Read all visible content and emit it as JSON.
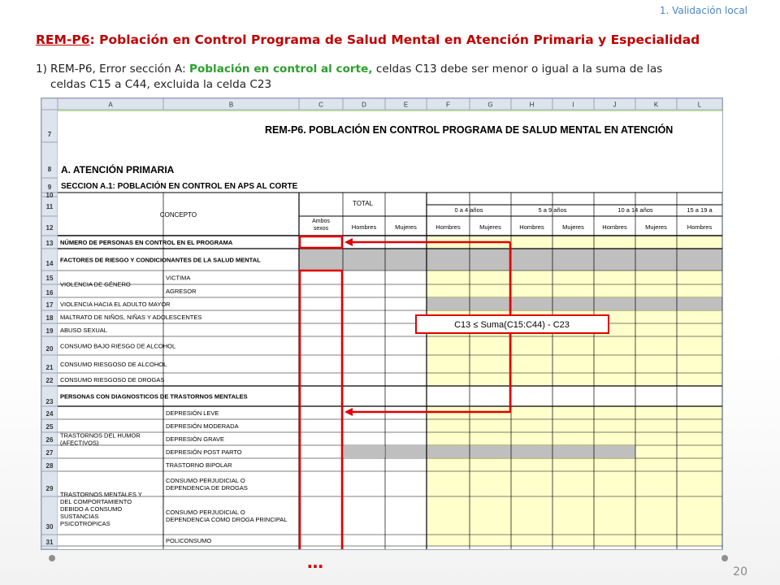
{
  "header": {
    "section_label": "1. Validación local",
    "title_code": "REM-P6",
    "title_rest": ": Población en Control  Programa de Salud  Mental en Atención Primaria y Especialidad"
  },
  "description": {
    "number": "1)",
    "line1_pre": "REM-P6, Error sección A: ",
    "line1_highlight": "Población en control al corte,",
    "line1_post": " celdas C13 debe ser menor o igual a la suma de las",
    "line2": "celdas C15 a C44, excluida la celda C23"
  },
  "sheet": {
    "column_letters": [
      "A",
      "B",
      "C",
      "D",
      "E",
      "F",
      "G",
      "H",
      "I",
      "J",
      "K",
      "L"
    ],
    "sheet_title": "REM-P6.  POBLACIÓN EN CONTROL PROGRAMA DE SALUD MENTAL EN ATENCIÓN",
    "section_title": "A. ATENCIÓN PRIMARIA",
    "subsection_title": "SECCION A.1: POBLACIÓN EN CONTROL EN APS AL CORTE",
    "header": {
      "concepto": "CONCEPTO",
      "total": "TOTAL",
      "ambos_sexos": "Ambos sexos",
      "hombres": "Hombres",
      "mujeres": "Mujeres",
      "age_groups": [
        "0 a 4 años",
        "5 a 9 años",
        "10 a 14 años",
        "15 a 19 a"
      ]
    },
    "rows": [
      {
        "row": "13",
        "label": "NÚMERO DE PERSONAS EN CONTROL EN EL PROGRAMA"
      },
      {
        "row": "14",
        "label": "FACTORES DE RIESGO Y CONDICIONANTES DE LA SALUD MENTAL"
      },
      {
        "row": "15",
        "group": "VIOLENCIA DE GÉNERO",
        "label": "VICTIMA"
      },
      {
        "row": "16",
        "label": "AGRESOR"
      },
      {
        "row": "17",
        "label": "VIOLENCIA  HACIA EL ADULTO MAYOR"
      },
      {
        "row": "18",
        "label": "MALTRATO DE NIÑOS, NIÑAS Y ADOLESCENTES"
      },
      {
        "row": "19",
        "label": "ABUSO SEXUAL"
      },
      {
        "row": "20",
        "label": "CONSUMO BAJO RIESGO DE ALCOHOL"
      },
      {
        "row": "21",
        "label": "CONSUMO RIESGOSO DE ALCOHOL"
      },
      {
        "row": "22",
        "label": "CONSUMO RIESGOSO DE DROGAS"
      },
      {
        "row": "23",
        "label": "PERSONAS CON DIAGNOSTICOS DE TRASTORNOS MENTALES"
      },
      {
        "row": "24",
        "group": "TRASTORNOS DEL HUMOR (AFECTIVOS)",
        "label": "DEPRESIÓN LEVE"
      },
      {
        "row": "25",
        "label": "DEPRESIÓN MODERADA"
      },
      {
        "row": "26",
        "label": "DEPRESIÓN GRAVE"
      },
      {
        "row": "27",
        "label": "DEPRESIÓN POST PARTO"
      },
      {
        "row": "28",
        "label": "TRASTORNO BIPOLAR"
      },
      {
        "row": "29",
        "group": "TRASTORNOS MENTALES Y DEL COMPORTAMIENTO DEBIDO A CONSUMO SUSTANCIAS PSICOTROPICAS",
        "label": "CONSUMO PERJUDICIAL O DEPENDENCIA DE DROGAS"
      },
      {
        "row": "30",
        "label": "CONSUMO PERJUDICIAL O DEPENDENCIA COMO DROGA PRINCIPAL"
      },
      {
        "row": "31",
        "label": "POLICONSUMO"
      }
    ],
    "extra_row_numbers": [
      "7",
      "8",
      "9",
      "10",
      "11",
      "12"
    ]
  },
  "annotation": {
    "formula": "C13 ≤ Suma(C15:C44) - C23",
    "ellipsis": "…",
    "highlight_color": "#e00000"
  },
  "colors": {
    "yellow_cell": "#ffffcc",
    "gray_cell": "#bfbfbf",
    "title_red": "#c00000",
    "green": "#2ca02c"
  },
  "footer": {
    "page_number": "20"
  }
}
